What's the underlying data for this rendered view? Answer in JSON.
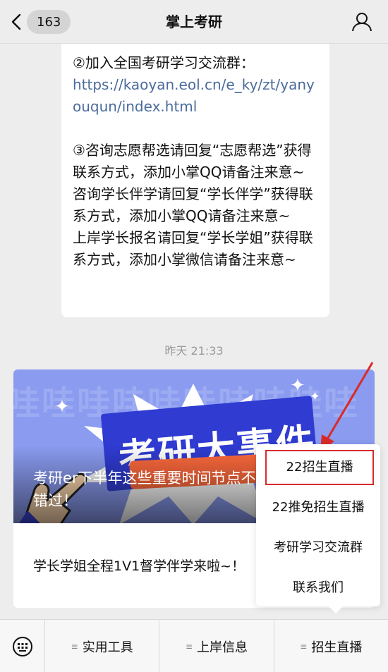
{
  "header": {
    "unread_count": "163",
    "title": "掌上考研"
  },
  "message": {
    "line1": "②加入全国考研学习交流群：",
    "link": "https://kaoyan.eol.cn/e_ky/zt/yanyouqun/index.html",
    "para3": "③咨询志愿帮选请回复“志愿帮选”获得联系方式，添加小掌QQ请备注来意~",
    "para4": "咨询学长伴学请回复“学长伴学”获得联系方式，添加小掌QQ请备注来意~",
    "para5": "上岸学长报名请回复“学长学姐”获得联系方式，添加小掌微信请备注来意~"
  },
  "timestamp": "昨天 21:33",
  "article": {
    "cover_text": "考研大事件",
    "title": "考研er下半年这些重要时间节点不要错过！",
    "description": "学长学姐全程1V1督学伴学来啦~！"
  },
  "popup_menu": {
    "items": [
      "22招生直播",
      "22推免招生直播",
      "考研学习交流群",
      "联系我们"
    ]
  },
  "bottom_menu": {
    "items": [
      "实用工具",
      "上岸信息",
      "招生直播"
    ]
  },
  "colors": {
    "accent_red": "#d92a2a",
    "link_blue": "#4a6b9c",
    "cover_blue": "#8a9bf0"
  }
}
